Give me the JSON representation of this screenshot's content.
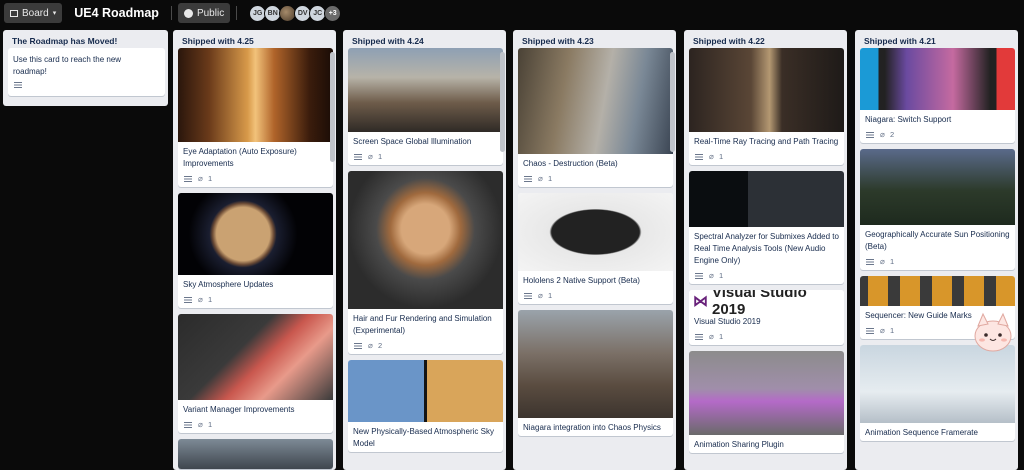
{
  "header": {
    "board_button": "Board",
    "board_icon": "board-icon",
    "title": "UE4 Roadmap",
    "visibility": "Public",
    "visibility_icon": "globe-icon",
    "members": [
      "JG",
      "BN",
      "",
      "DV",
      "JC"
    ],
    "more_members": "+3"
  },
  "lists": [
    {
      "title": "The Roadmap has Moved!",
      "cards": [
        {
          "title": "Use this card to reach the new roadmap!",
          "has_description": true
        }
      ]
    },
    {
      "title": "Shipped with 4.25",
      "cards": [
        {
          "title": "Eye Adaptation (Auto Exposure) Improvements",
          "attachments": "1"
        },
        {
          "title": "Sky Atmosphere Updates",
          "attachments": "1"
        },
        {
          "title": "Variant Manager Improvements",
          "attachments": "1"
        }
      ]
    },
    {
      "title": "Shipped with 4.24",
      "cards": [
        {
          "title": "Screen Space Global Illumination",
          "attachments": "1"
        },
        {
          "title": "Hair and Fur Rendering and Simulation (Experimental)",
          "attachments": "2"
        },
        {
          "title": "New Physically-Based Atmospheric Sky Model"
        }
      ]
    },
    {
      "title": "Shipped with 4.23",
      "cards": [
        {
          "title": "Chaos - Destruction (Beta)",
          "attachments": "1"
        },
        {
          "title": "Hololens 2 Native Support (Beta)",
          "attachments": "1"
        },
        {
          "title": "Niagara integration into Chaos Physics"
        }
      ]
    },
    {
      "title": "Shipped with 4.22",
      "cards": [
        {
          "title": "Real-Time Ray Tracing and Path Tracing",
          "attachments": "1"
        },
        {
          "title": "Spectral Analyzer for Submixes Added to Real Time Analysis Tools (New Audio Engine Only)",
          "attachments": "1"
        },
        {
          "title": "Visual Studio 2019",
          "attachments": "1",
          "cover_text": "Visual Studio 2019"
        },
        {
          "title": "Animation Sharing Plugin"
        }
      ]
    },
    {
      "title": "Shipped with 4.21",
      "cards": [
        {
          "title": "Niagara: Switch Support",
          "attachments": "2"
        },
        {
          "title": "Geographically Accurate Sun Positioning (Beta)",
          "attachments": "1"
        },
        {
          "title": "Sequencer: New Guide Marks",
          "attachments": "1"
        },
        {
          "title": "Animation Sequence Framerate"
        }
      ]
    }
  ],
  "colors": {
    "background": "#0a0a0a",
    "list_background": "#ebecf0",
    "card_background": "#ffffff",
    "title_text": "#172b4d"
  }
}
